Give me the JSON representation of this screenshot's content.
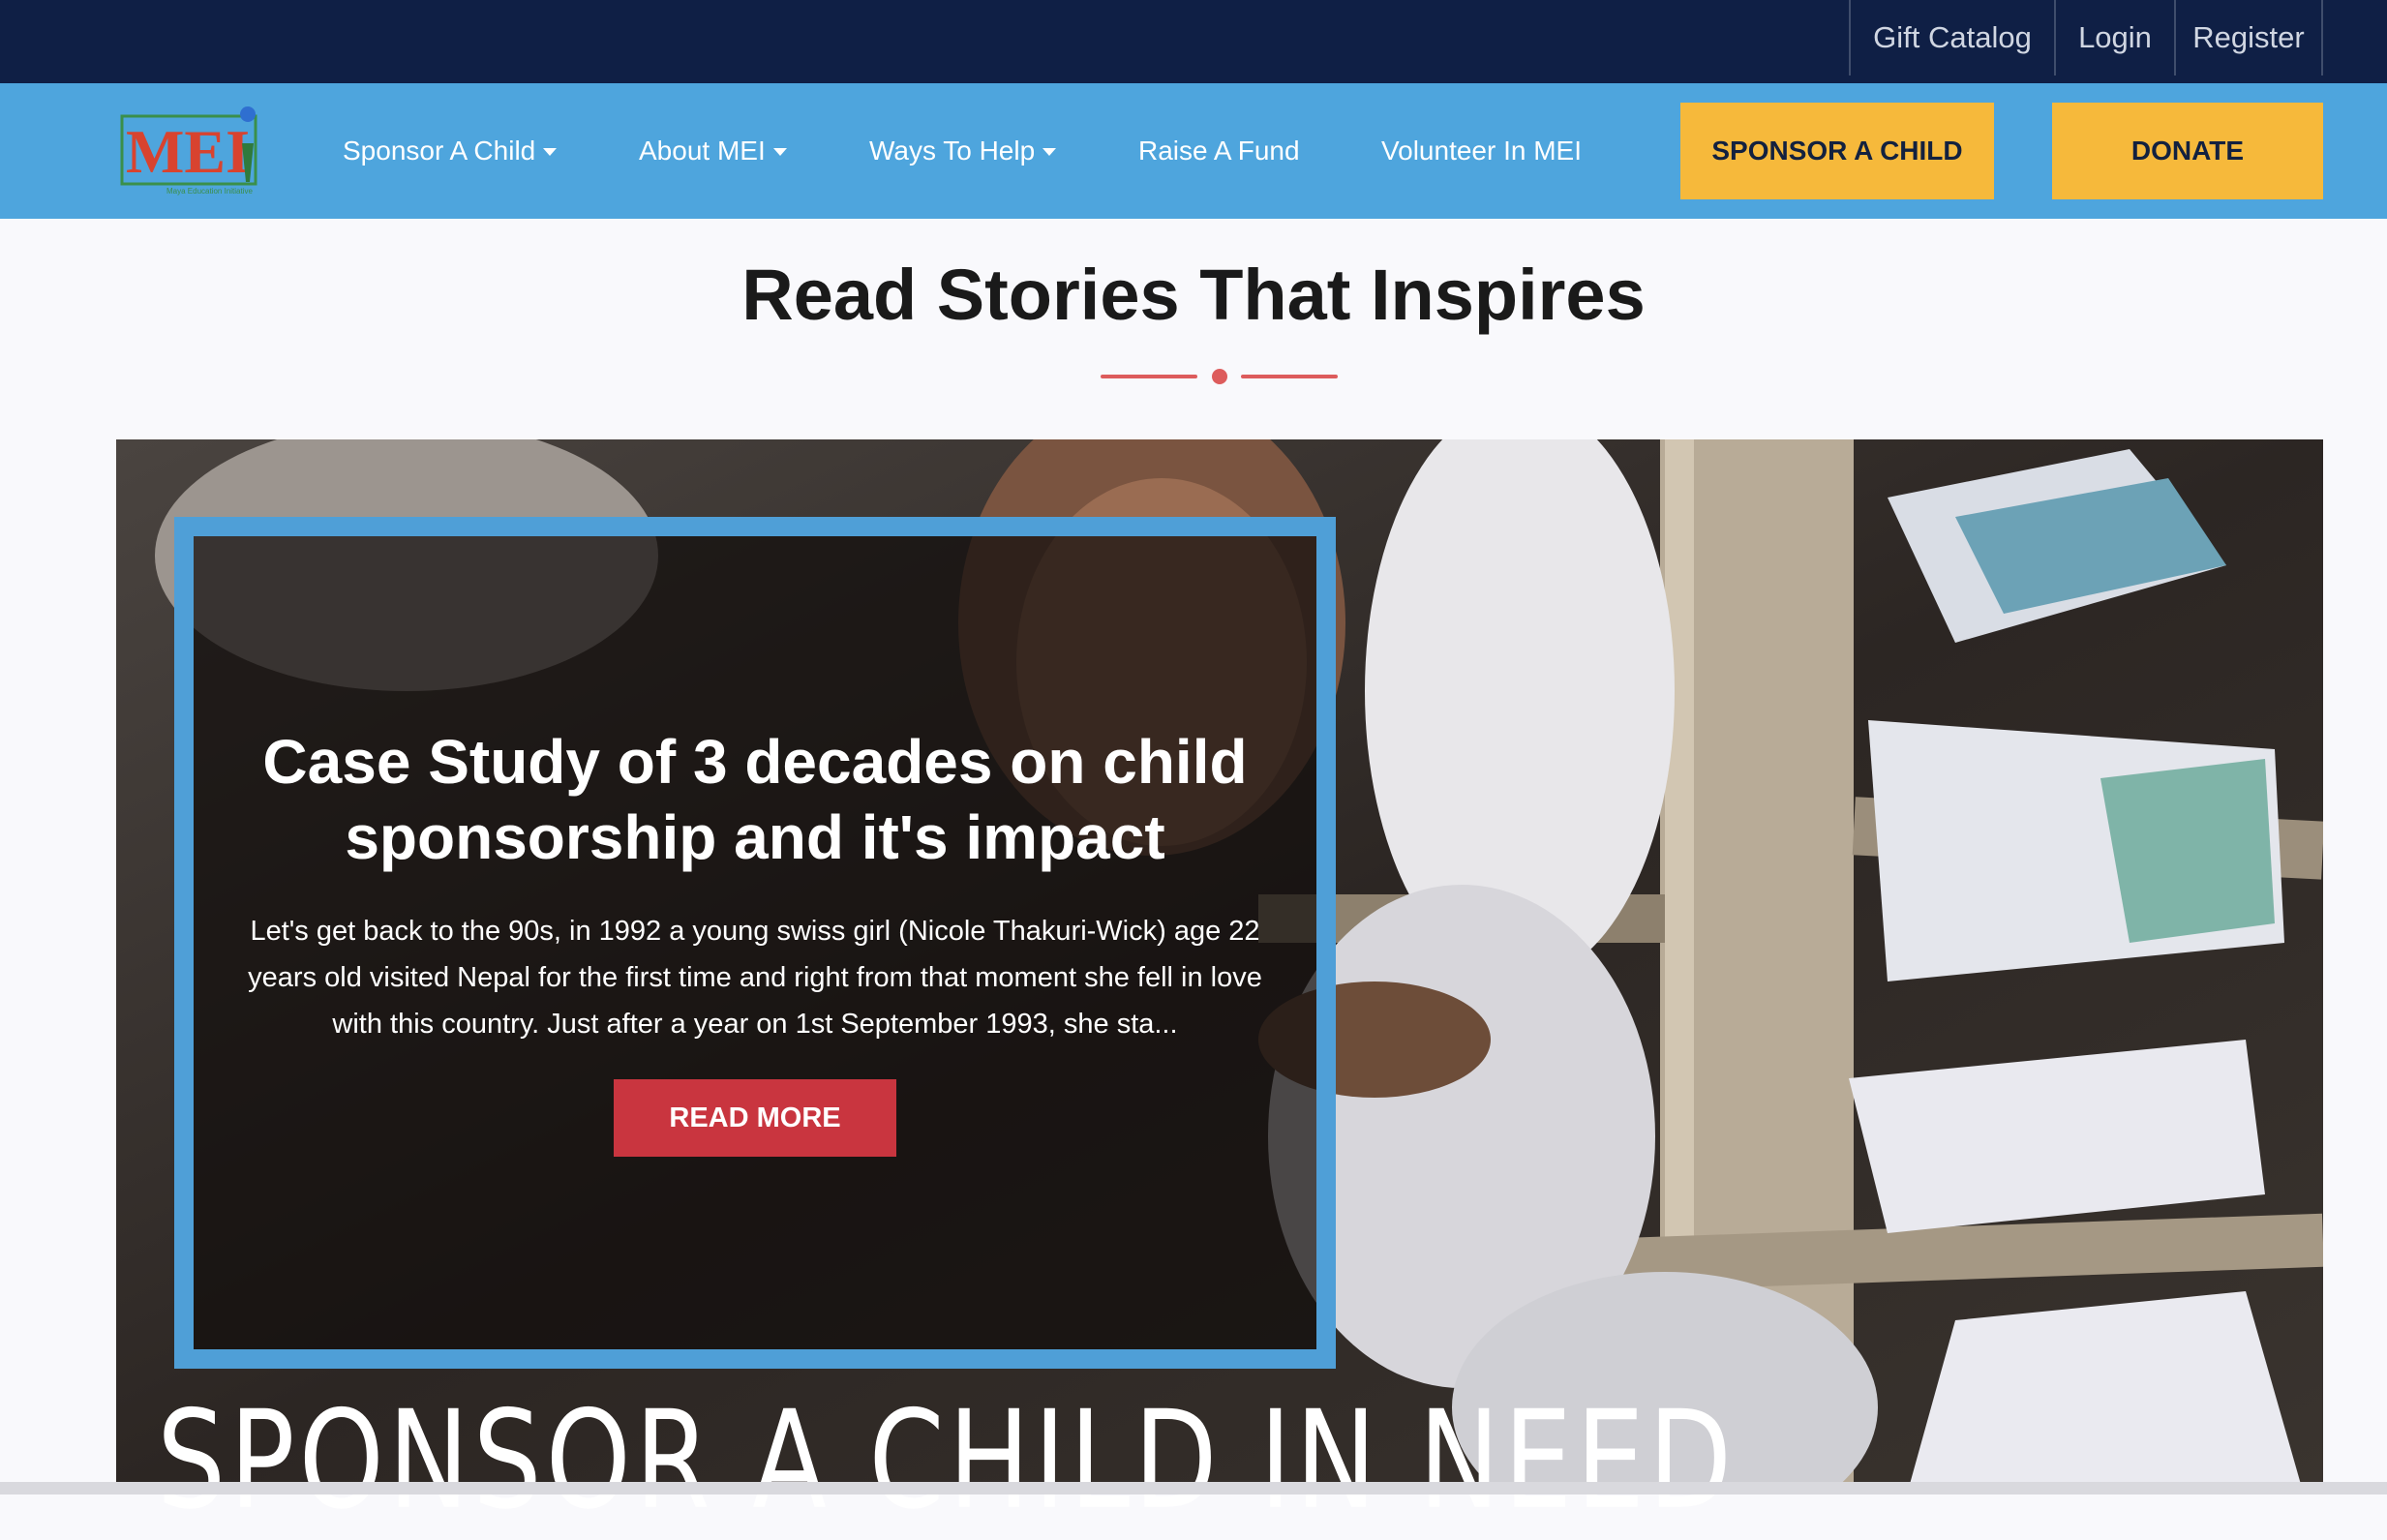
{
  "topbar": {
    "gift_catalog": "Gift Catalog",
    "login": "Login",
    "register": "Register"
  },
  "nav": {
    "logo_text": "MEI",
    "logo_tagline": "Maya Education Initiative",
    "items": [
      {
        "label": "Sponsor A Child",
        "dropdown": true
      },
      {
        "label": "About MEI",
        "dropdown": true
      },
      {
        "label": "Ways To Help",
        "dropdown": true
      },
      {
        "label": "Raise A Fund",
        "dropdown": false
      },
      {
        "label": "Volunteer In MEI",
        "dropdown": false
      }
    ],
    "sponsor_cta": "SPONSOR A CHILD",
    "donate_cta": "DONATE"
  },
  "section": {
    "title": "Read Stories That Inspires"
  },
  "hero": {
    "title": "Case Study of 3 decades on child sponsorship and it's impact",
    "body": "Let's get back to the 90s, in 1992 a young swiss girl (Nicole Thakuri-Wick)  age 22 years old visited Nepal for the first time and right from that moment she fell in love with this country. Just after a year on 1st September 1993, she sta...",
    "read_more": "READ MORE",
    "banner": "SPONSOR A CHILD IN NEED"
  },
  "colors": {
    "topbar": "#0f1f45",
    "nav": "#4ea5dd",
    "cta": "#f6b93b",
    "accent_red": "#dd5c5c",
    "button_red": "#c9353f",
    "card_border": "#4f9fd7"
  }
}
